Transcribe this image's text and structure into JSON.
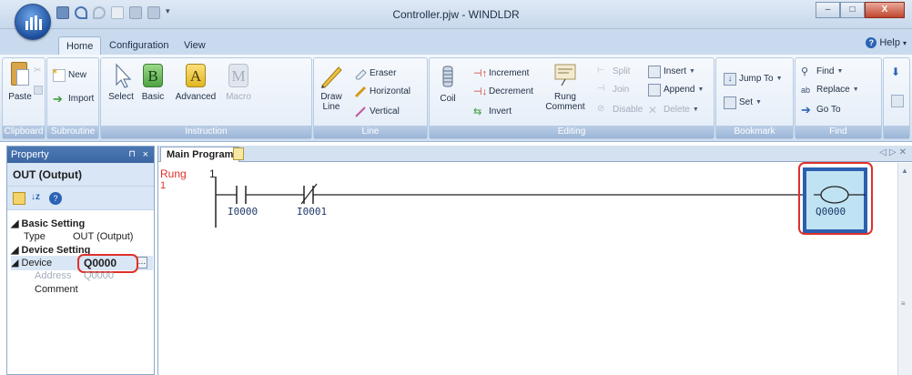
{
  "window": {
    "title": "Controller.pjw - WINDLDR",
    "buttons": [
      "–",
      "□",
      "X"
    ]
  },
  "ribbon_tabs": [
    "Home",
    "Configuration",
    "View"
  ],
  "help_label": "Help",
  "groups": {
    "clipboard": {
      "label": "Clipboard",
      "paste": "Paste"
    },
    "subroutine": {
      "label": "Subroutine",
      "new": "New",
      "import": "Import"
    },
    "instruction": {
      "label": "Instruction",
      "select": "Select",
      "basic": "Basic",
      "advanced": "Advanced",
      "macro": "Macro"
    },
    "line": {
      "label": "Line",
      "draw_line": "Draw Line",
      "eraser": "Eraser",
      "horizontal": "Horizontal",
      "vertical": "Vertical"
    },
    "editing": {
      "label": "Editing",
      "coil": "Coil",
      "increment": "Increment",
      "decrement": "Decrement",
      "invert": "Invert",
      "rung_comment": "Rung Comment",
      "split": "Split",
      "join": "Join",
      "disable": "Disable",
      "insert": "Insert",
      "append": "Append",
      "delete": "Delete"
    },
    "bookmark": {
      "label": "Bookmark",
      "jump_to": "Jump To",
      "set": "Set"
    },
    "find": {
      "label": "Find",
      "find": "Find",
      "replace": "Replace",
      "go_to": "Go To"
    }
  },
  "property_panel": {
    "header": "Property",
    "title": "OUT (Output)",
    "basic_setting": "Basic Setting",
    "type_label": "Type",
    "type_value": "OUT (Output)",
    "device_setting": "Device Setting",
    "device_label": "Device",
    "device_value": "Q0000",
    "address_label": "Address",
    "address_value": "Q0000",
    "comment_label": "Comment"
  },
  "document": {
    "tab": "Main Program",
    "rung_label": "Rung",
    "rung_number": "1",
    "rung_sub": "1",
    "contacts": [
      "I0000",
      "I0001"
    ],
    "coil": "Q0000"
  },
  "colors": {
    "highlight": "#e0302a",
    "panel_header": "#3c67a2",
    "coil_fill": "#bfe3f2"
  }
}
